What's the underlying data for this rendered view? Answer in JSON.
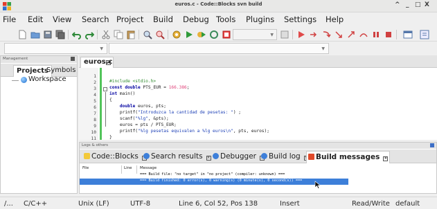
{
  "window": {
    "title": "euros.c - Code::Blocks svn build",
    "controls": [
      "^",
      "_",
      "□",
      "X"
    ]
  },
  "menu": [
    "File",
    "Edit",
    "View",
    "Search",
    "Project",
    "Build",
    "Debug",
    "Tools",
    "Plugins",
    "Settings",
    "Help"
  ],
  "toolbar": {
    "icons": [
      "new-file-icon",
      "open-icon",
      "save-icon",
      "save-all-icon",
      "undo-icon",
      "redo-icon",
      "cut-icon",
      "copy-icon",
      "paste-icon",
      "find-icon",
      "replace-icon",
      "build-icon",
      "run-icon",
      "build-run-icon",
      "rebuild-icon",
      "abort-icon",
      "debug-run-icon",
      "debug-run-to-cursor-icon",
      "next-line-icon",
      "step-into-icon",
      "step-out-icon",
      "next-instruction-icon",
      "break-icon",
      "stop-debug-icon",
      "debug-windows-icon",
      "info-icon"
    ]
  },
  "management": {
    "header": "Management",
    "tabs": [
      "Projects",
      "Symbols"
    ],
    "active_tab": "Projects",
    "tree": [
      {
        "label": "Workspace"
      }
    ]
  },
  "editor": {
    "tab_label": "euros.c",
    "lines": [
      {
        "n": "1",
        "text": "#include <stdio.h>"
      },
      {
        "n": "2",
        "text": "const double PTS_EUR = 166.386;"
      },
      {
        "n": "3",
        "text": "int main()"
      },
      {
        "n": "4",
        "text": "{"
      },
      {
        "n": "5",
        "text": "    double euros, pts;"
      },
      {
        "n": "6",
        "text": "    printf(\"Introduzca la cantidad de pesetas: \") ;"
      },
      {
        "n": "7",
        "text": "    scanf(\"%lg\", &pts);"
      },
      {
        "n": "8",
        "text": "    euros = pts / PTS_EUR;"
      },
      {
        "n": "9",
        "text": "    printf(\"%lg pesetas equivalen a %lg euros\\n\", pts, euros);"
      },
      {
        "n": "10",
        "text": "}"
      },
      {
        "n": "11",
        "text": ""
      }
    ]
  },
  "logs": {
    "header": "Logs & others",
    "tabs": [
      {
        "label": "Code::Blocks",
        "icon": "codeblocks-icon",
        "active": false
      },
      {
        "label": "Search results",
        "icon": "search-icon",
        "active": false
      },
      {
        "label": "Debugger",
        "icon": "debugger-icon",
        "active": false
      },
      {
        "label": "Build log",
        "icon": "build-log-icon",
        "active": false
      },
      {
        "label": "Build messages",
        "icon": "build-messages-icon",
        "active": true
      }
    ],
    "columns": [
      "File",
      "Line",
      "Message"
    ],
    "rows": [
      {
        "file": "",
        "line": "",
        "message": "=== Build file: \"no target\" in \"no project\" (compiler: unknown) ===",
        "selected": false
      },
      {
        "file": "",
        "line": "",
        "message": "=== Build finished: 0 error(s), 0 warning(s) (0 minute(s), 0 second(s)) ===",
        "selected": true
      }
    ]
  },
  "status": {
    "path": "/...",
    "language": "C/C++",
    "eol": "Unix (LF)",
    "encoding": "UTF-8",
    "position": "Line 6, Col 52, Pos 138",
    "mode": "Insert",
    "access": "Read/Write",
    "profile": "default"
  },
  "colors": {
    "keyword": "#0000a0",
    "preprocessor": "#2e8b2e",
    "number": "#e0447a",
    "string": "#1c3fb6",
    "changebar": "#52c45a",
    "selection": "#3d7fd9"
  }
}
